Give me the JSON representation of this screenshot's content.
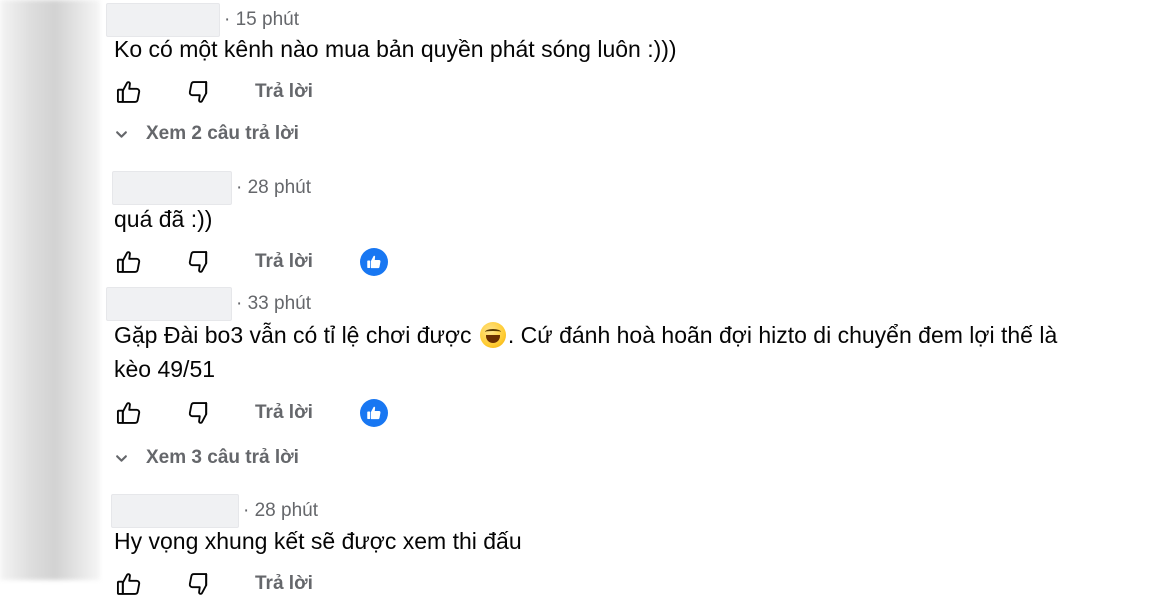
{
  "comments": [
    {
      "time": "· 15 phút",
      "text": "Ko có một kênh nào mua bản quyền phát sóng luôn :)))",
      "reply_label": "Trả lời",
      "view_replies": "Xem 2 câu trả lời",
      "has_reaction": false
    },
    {
      "time": "· 28 phút",
      "text": "quá đã :))",
      "reply_label": "Trả lời",
      "has_reaction": true,
      "reaction_icon": "like-reaction-icon"
    },
    {
      "time": "· 33 phút",
      "text_before_emoji": "Gặp Đài bo3 vẫn có tỉ lệ chơi được",
      "emoji": "laughing-emoji",
      "text_after_emoji": ". Cứ đánh hoà hoãn đợi hizto di chuyển đem lợi thế là",
      "text_line2": "kèo 49/51",
      "reply_label": "Trả lời",
      "view_replies": "Xem 3 câu trả lời",
      "has_reaction": true,
      "reaction_icon": "like-reaction-icon"
    },
    {
      "time": "· 28 phút",
      "text": "Hy vọng xhung kết sẽ được xem thi đấu",
      "reply_label": "Trả lời",
      "has_reaction": false
    }
  ],
  "icons": {
    "like": "thumbs-up-outline-icon",
    "dislike": "thumbs-down-outline-icon",
    "chevron": "chevron-down-icon"
  },
  "colors": {
    "secondary_text": "#65676b",
    "primary_text": "#050505",
    "reaction_blue": "#1877f2"
  }
}
